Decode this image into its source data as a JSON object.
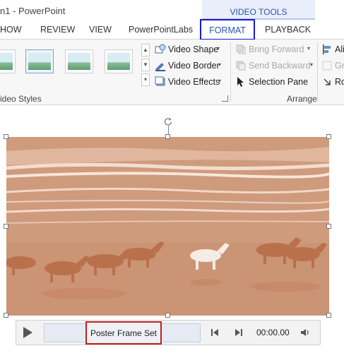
{
  "window": {
    "title": "n1 - PowerPoint"
  },
  "contextual": {
    "group_label": "VIDEO TOOLS"
  },
  "tabs": [
    {
      "label": "HOW"
    },
    {
      "label": "REVIEW"
    },
    {
      "label": "VIEW"
    },
    {
      "label": "PowerPointLabs"
    },
    {
      "label": "FORMAT",
      "selected": true
    },
    {
      "label": "PLAYBACK"
    }
  ],
  "ribbon": {
    "video_styles": {
      "group_label": "ideo Styles",
      "commands": [
        {
          "label": "Video Shape",
          "icon": "video-shape-icon"
        },
        {
          "label": "Video Border",
          "icon": "video-border-icon"
        },
        {
          "label": "Video Effects",
          "icon": "video-effects-icon"
        }
      ]
    },
    "arrange": {
      "group_label": "Arrange",
      "commands": [
        {
          "label": "Bring Forward",
          "icon": "bring-forward-icon",
          "enabled": false
        },
        {
          "label": "Send Backward",
          "icon": "send-backward-icon",
          "enabled": false
        },
        {
          "label": "Selection Pane",
          "icon": "selection-pane-icon",
          "enabled": true
        }
      ],
      "partial_commands": [
        {
          "label": "Ali",
          "icon": "align-icon"
        },
        {
          "label": "Gr",
          "icon": "group-icon"
        },
        {
          "label": "Ro",
          "icon": "rotate-icon"
        }
      ]
    }
  },
  "player": {
    "poster_label": "Poster Frame Set",
    "time": "00:00.00"
  },
  "colors": {
    "accent": "#2a55b0",
    "highlight_blue": "#1a1acc",
    "highlight_red": "#c51f1f",
    "video_tint": "#cc9577"
  }
}
